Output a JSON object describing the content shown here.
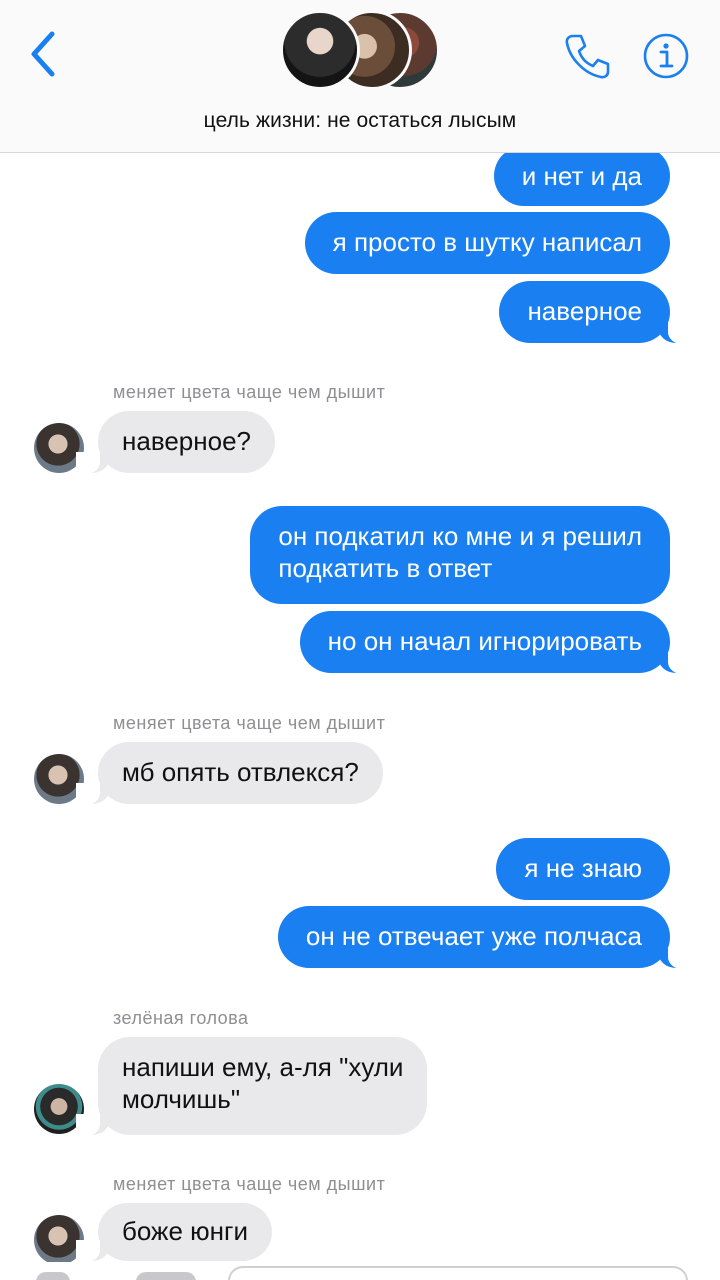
{
  "header": {
    "title": "цель жизни: не остаться лысым",
    "back_icon": "chevron-left-icon",
    "phone_icon": "phone-icon",
    "info_icon": "info-icon",
    "accent_color": "#1a80f2"
  },
  "messages": [
    {
      "dir": "out",
      "text": "и нет и да"
    },
    {
      "dir": "out",
      "text": "я просто в шутку написал"
    },
    {
      "dir": "out",
      "text": "наверное"
    },
    {
      "dir": "in",
      "sender": "меняет цвета чаще чем дышит",
      "text": "наверное?"
    },
    {
      "dir": "out",
      "lines": [
        "он подкатил ко мне и я решил",
        "подкатить в ответ"
      ]
    },
    {
      "dir": "out",
      "text": "но он начал игнорировать"
    },
    {
      "dir": "in",
      "sender": "меняет цвета чаще чем дышит",
      "text": "мб опять отвлекся?"
    },
    {
      "dir": "out",
      "text": "я не знаю"
    },
    {
      "dir": "out",
      "text": "он не отвечает уже полчаса"
    },
    {
      "dir": "in",
      "sender": "зелёная голова",
      "lines": [
        "напиши ему, а-ля \"хули",
        "молчишь\""
      ]
    },
    {
      "dir": "in",
      "sender": "меняет цвета чаще чем дышит",
      "text": "боже юнги"
    }
  ],
  "colors": {
    "outgoing_bubble": "#1a80f2",
    "incoming_bubble": "#e9e9eb",
    "sender_label": "#8e8e93"
  }
}
